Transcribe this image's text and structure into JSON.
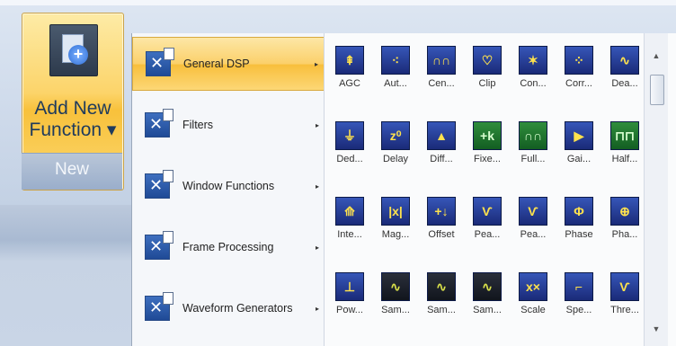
{
  "ribbon": {
    "add_function": {
      "label_line1": "Add New",
      "label_line2": "Function ▾",
      "icon": "add-document-icon"
    },
    "group_label": "New"
  },
  "menu": {
    "items": [
      {
        "label": "General DSP",
        "active": true
      },
      {
        "label": "Filters",
        "active": false
      },
      {
        "label": "Window Functions",
        "active": false
      },
      {
        "label": "Frame Processing",
        "active": false
      },
      {
        "label": "Waveform Generators",
        "active": false
      }
    ],
    "submenu_arrow": "▸"
  },
  "gallery": {
    "items": [
      {
        "label": "AGC",
        "icon": "agc-icon",
        "glyph": "⇞",
        "style": "blue"
      },
      {
        "label": "Aut...",
        "icon": "autocorrelation-icon",
        "glyph": "⁖",
        "style": "blue"
      },
      {
        "label": "Cen...",
        "icon": "center-icon",
        "glyph": "∩∩",
        "style": "blue"
      },
      {
        "label": "Clip",
        "icon": "clip-icon",
        "glyph": "♡",
        "style": "blue"
      },
      {
        "label": "Con...",
        "icon": "convolution-icon",
        "glyph": "✶",
        "style": "blue"
      },
      {
        "label": "Corr...",
        "icon": "correlation-icon",
        "glyph": "⁘",
        "style": "blue"
      },
      {
        "label": "Dea...",
        "icon": "deadband-icon",
        "glyph": "∿",
        "style": "blue"
      },
      {
        "label": "Ded...",
        "icon": "dedc-icon",
        "glyph": "⏚",
        "style": "blue"
      },
      {
        "label": "Delay",
        "icon": "delay-icon",
        "glyph": "z⁰",
        "style": "blue"
      },
      {
        "label": "Diff...",
        "icon": "differentiate-icon",
        "glyph": "▲",
        "style": "blue"
      },
      {
        "label": "Fixe...",
        "icon": "fixed-icon",
        "glyph": "+k",
        "style": "green"
      },
      {
        "label": "Full...",
        "icon": "full-wave-icon",
        "glyph": "∩∩",
        "style": "green"
      },
      {
        "label": "Gai...",
        "icon": "gain-icon",
        "glyph": "▶",
        "style": "blue"
      },
      {
        "label": "Half...",
        "icon": "half-wave-icon",
        "glyph": "⊓⊓",
        "style": "green"
      },
      {
        "label": "Inte...",
        "icon": "integrate-icon",
        "glyph": "⟰",
        "style": "blue"
      },
      {
        "label": "Mag...",
        "icon": "magnitude-icon",
        "glyph": "|x|",
        "style": "blue"
      },
      {
        "label": "Offset",
        "icon": "offset-icon",
        "glyph": "+↓",
        "style": "blue"
      },
      {
        "label": "Pea...",
        "icon": "peak-icon",
        "glyph": "Ѵ",
        "style": "blue"
      },
      {
        "label": "Pea...",
        "icon": "peak-detect-icon",
        "glyph": "Ѵ",
        "style": "blue"
      },
      {
        "label": "Phase",
        "icon": "phase-icon",
        "glyph": "Φ",
        "style": "blue"
      },
      {
        "label": "Pha...",
        "icon": "phase-unwrap-icon",
        "glyph": "⊕",
        "style": "blue"
      },
      {
        "label": "Pow...",
        "icon": "power-icon",
        "glyph": "⊥",
        "style": "blue"
      },
      {
        "label": "Sam...",
        "icon": "sample-icon",
        "glyph": "∿",
        "style": "dark"
      },
      {
        "label": "Sam...",
        "icon": "sample-hold-icon",
        "glyph": "∿",
        "style": "dark"
      },
      {
        "label": "Sam...",
        "icon": "sample-rate-icon",
        "glyph": "∿",
        "style": "dark"
      },
      {
        "label": "Scale",
        "icon": "scale-icon",
        "glyph": "x×",
        "style": "blue"
      },
      {
        "label": "Spe...",
        "icon": "spectrum-icon",
        "glyph": "⌐",
        "style": "blue"
      },
      {
        "label": "Thre...",
        "icon": "threshold-icon",
        "glyph": "Ѵ",
        "style": "blue"
      }
    ]
  },
  "scrollbar": {
    "up": "▲",
    "down": "▼"
  }
}
